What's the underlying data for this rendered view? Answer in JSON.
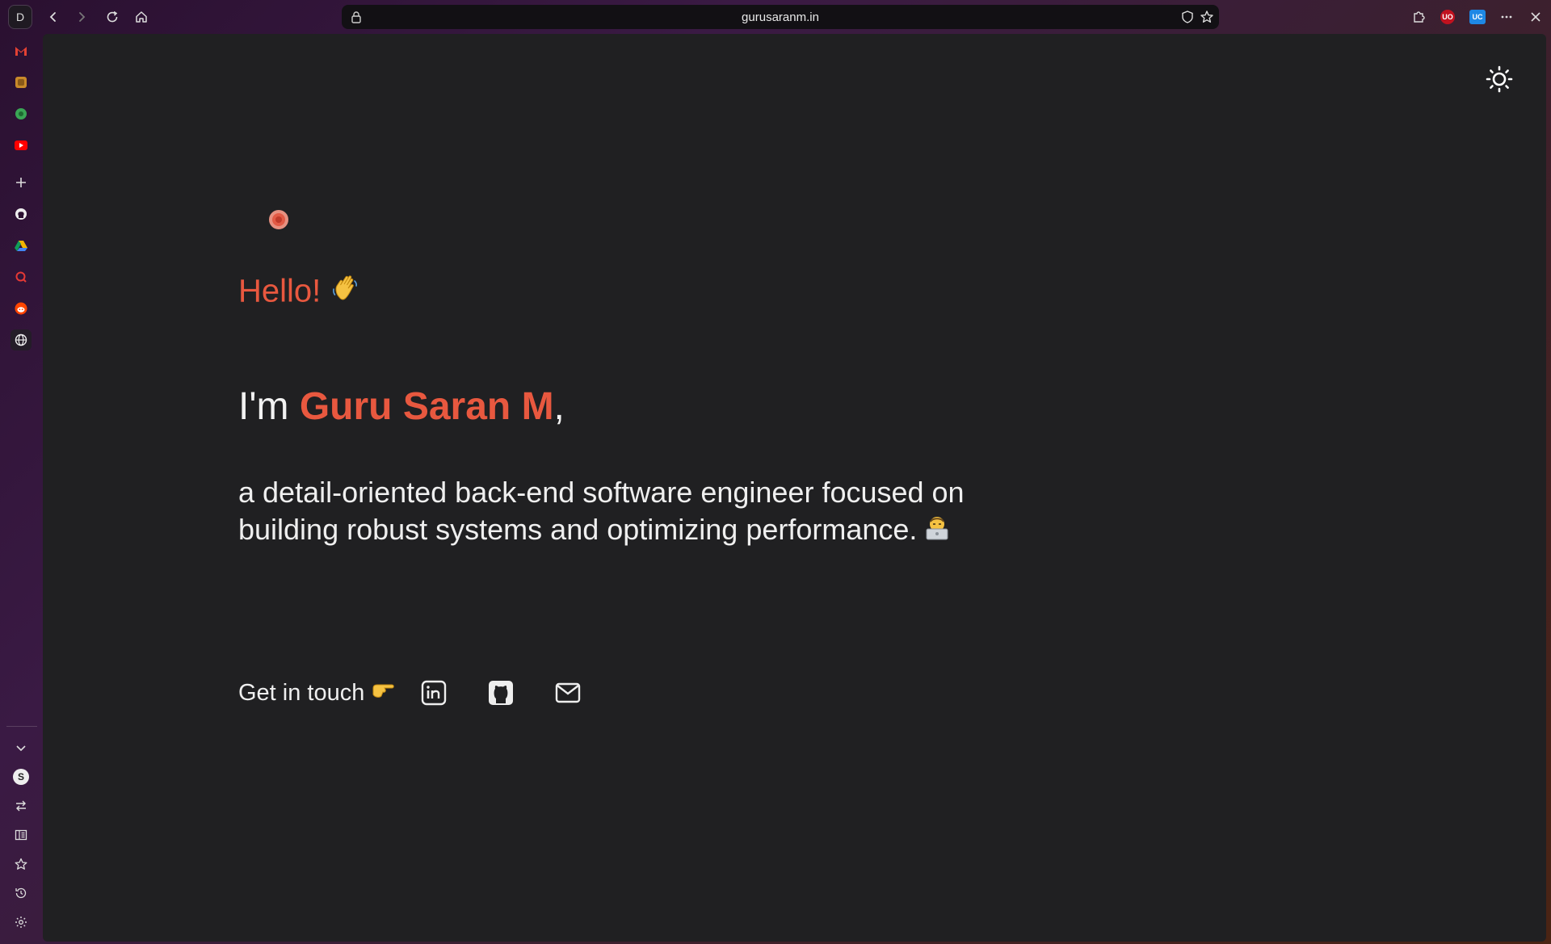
{
  "browser": {
    "profile_initial": "D",
    "url": "gurusaranm.in",
    "extensions": [
      {
        "name": "ublock",
        "label": "UO",
        "color": "#c1121f"
      },
      {
        "name": "ext-uc",
        "label": "UC",
        "color": "#1e88e5"
      }
    ]
  },
  "sidebar": {
    "account_initial": "S",
    "items": [
      {
        "name": "gmail-icon"
      },
      {
        "name": "app-orange-icon"
      },
      {
        "name": "whatsapp-icon"
      },
      {
        "name": "youtube-icon"
      },
      {
        "name": "add-panel-icon"
      },
      {
        "name": "github-icon"
      },
      {
        "name": "google-drive-icon"
      },
      {
        "name": "search-app-icon"
      },
      {
        "name": "reddit-icon"
      },
      {
        "name": "globe-icon"
      }
    ]
  },
  "hero": {
    "greeting": "Hello!",
    "greeting_emoji": "waving-hand",
    "intro_prefix": "I'm ",
    "name": "Guru Saran M",
    "intro_suffix": ",",
    "tagline": "a detail-oriented back-end software engineer focused on building robust systems and optimizing performance.",
    "tagline_emoji": "technologist"
  },
  "contact": {
    "label": "Get in touch",
    "pointer_emoji": "pointing-right",
    "links": [
      {
        "name": "linkedin-icon"
      },
      {
        "name": "github-icon"
      },
      {
        "name": "email-icon"
      }
    ]
  },
  "colors": {
    "accent": "#e8583f",
    "content_bg": "#202022",
    "text": "#efefef"
  }
}
